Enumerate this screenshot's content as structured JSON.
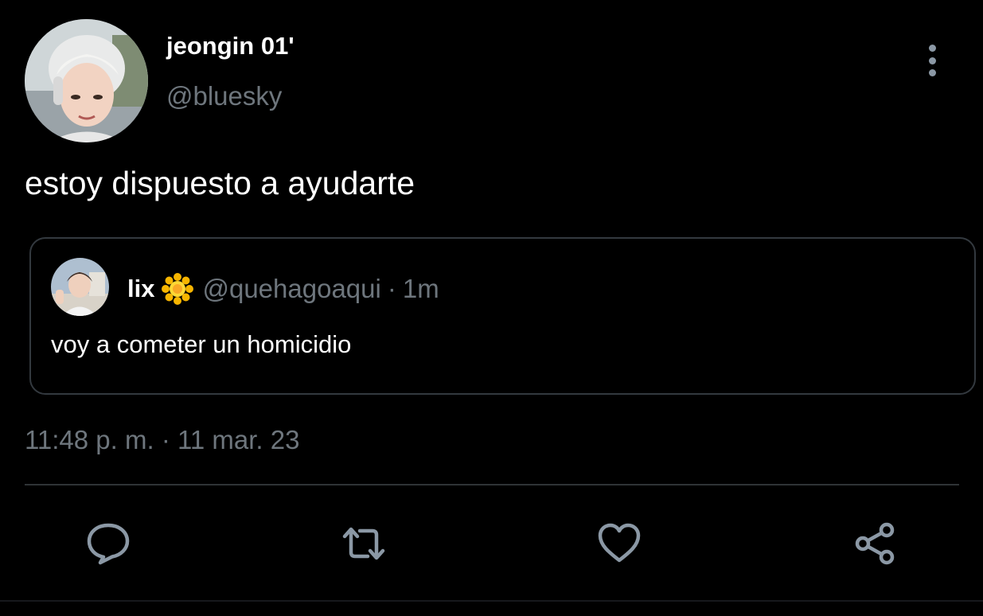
{
  "post": {
    "author": {
      "display_name": "jeongin 01'",
      "handle": "@bluesky"
    },
    "text": "estoy dispuesto a ayudarte",
    "timestamp": "11:48 p. m. · 11 mar. 23",
    "menu_icon": "more-vertical-icon"
  },
  "quoted_post": {
    "author": {
      "display_name": "lix",
      "name_emoji": "sun-flower-icon",
      "handle": "@quehagoaqui",
      "separator": "·",
      "time": "1m"
    },
    "text": "voy a cometer un homicidio"
  },
  "actions": [
    {
      "name": "reply",
      "icon": "reply-icon"
    },
    {
      "name": "repost",
      "icon": "repost-icon"
    },
    {
      "name": "like",
      "icon": "heart-icon"
    },
    {
      "name": "share",
      "icon": "share-icon"
    }
  ],
  "colors": {
    "background": "#000000",
    "primary_text": "#ffffff",
    "secondary_text": "#6e767d",
    "border": "#33393f",
    "icon": "#8b98a5"
  }
}
